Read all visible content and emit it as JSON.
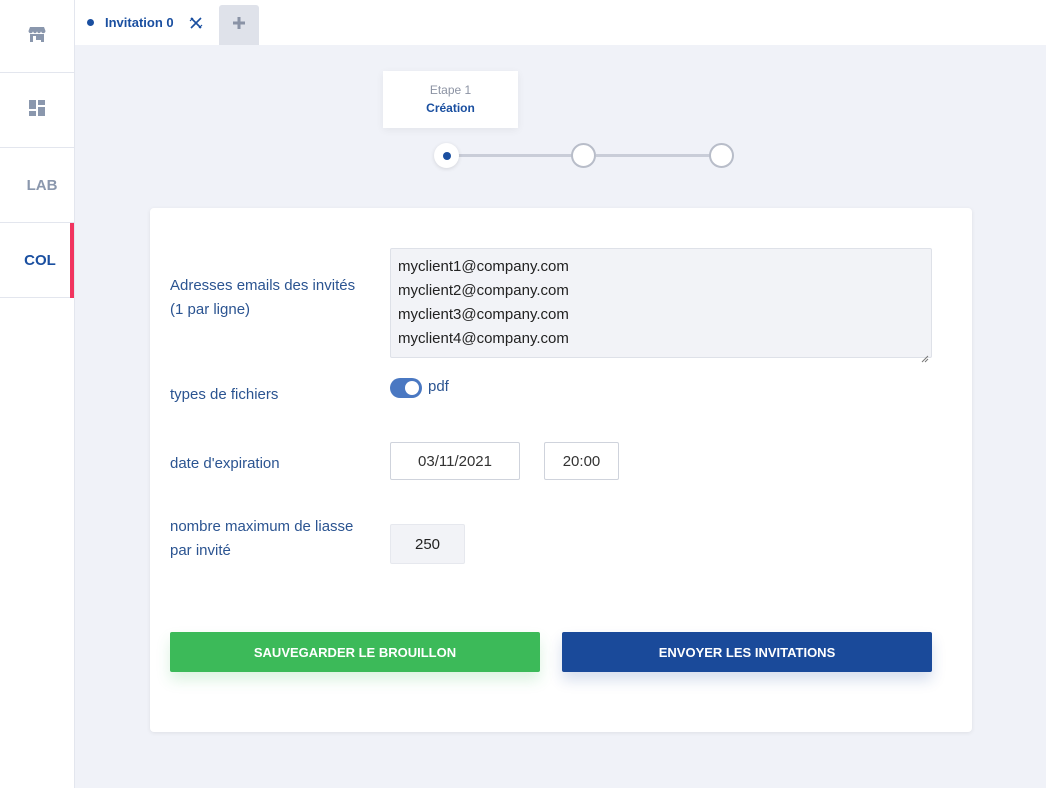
{
  "sidebar": {
    "items": [
      {
        "name": "shop-icon"
      },
      {
        "name": "dashboard-icon"
      },
      {
        "label": "LAB"
      },
      {
        "label": "COL",
        "active": true
      }
    ]
  },
  "tabs": {
    "active_label": "Invitation 0",
    "close_icon": "close-icon",
    "add_icon": "plus-icon"
  },
  "stepper": {
    "step_number": "Etape 1",
    "step_name": "Création",
    "total_steps": 3,
    "current_step": 1
  },
  "form": {
    "emails_label_line1": "Adresses emails des invités",
    "emails_label_line2": "(1 par ligne)",
    "emails": [
      "myclient1@company.com",
      "myclient2@company.com",
      "myclient3@company.com",
      "myclient4@company.com"
    ],
    "file_types_label": "types de fichiers",
    "file_type_option": "pdf",
    "file_type_enabled": true,
    "expiration_label": "date d'expiration",
    "expiration_date": "03/11/2021",
    "expiration_time": "20:00",
    "max_label_line1": "nombre maximum de liasse",
    "max_label_line2": "par invité",
    "max_value": "250"
  },
  "actions": {
    "save_label": "SAUVEGARDER LE BROUILLON",
    "send_label": "ENVOYER LES INVITATIONS"
  },
  "colors": {
    "primary": "#1a4a9a",
    "success": "#3cba59",
    "accent": "#f1355f",
    "background": "#f0f2f8"
  }
}
